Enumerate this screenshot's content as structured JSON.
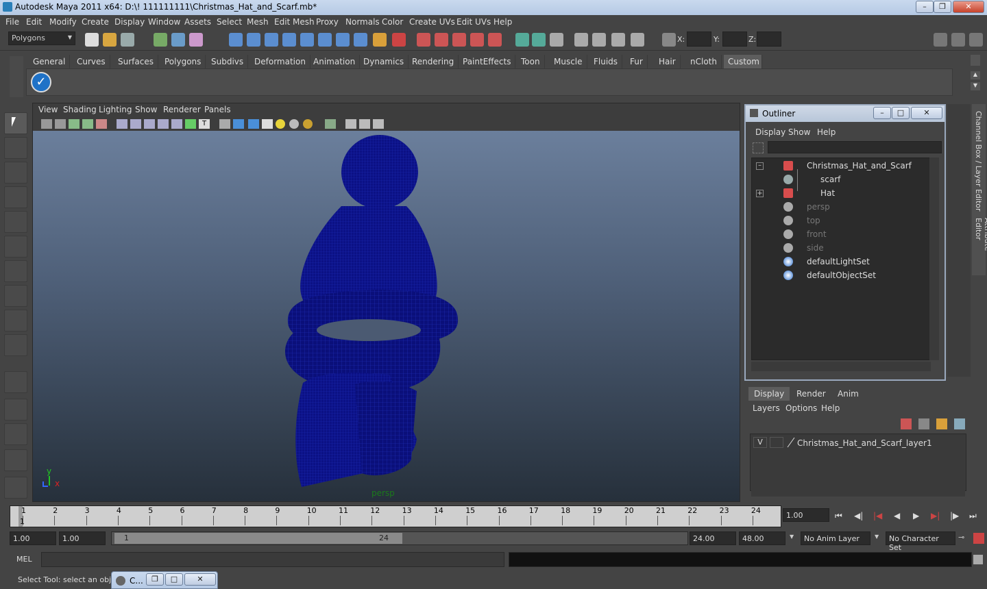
{
  "window": {
    "title": "Autodesk Maya 2011 x64: D:\\! 111111111\\Christmas_Hat_and_Scarf.mb*"
  },
  "menus": [
    "File",
    "Edit",
    "Modify",
    "Create",
    "Display",
    "Window",
    "Assets",
    "Select",
    "Mesh",
    "Edit Mesh",
    "Proxy",
    "Normals",
    "Color",
    "Create UVs",
    "Edit UVs",
    "Help"
  ],
  "status": {
    "mode": "Polygons",
    "x_label": "X:",
    "y_label": "Y:",
    "z_label": "Z:"
  },
  "shelf": {
    "tabs": [
      "General",
      "Curves",
      "Surfaces",
      "Polygons",
      "Subdivs",
      "Deformation",
      "Animation",
      "Dynamics",
      "Rendering",
      "PaintEffects",
      "Toon",
      "Muscle",
      "Fluids",
      "Fur",
      "Hair",
      "nCloth",
      "Custom"
    ],
    "active": "Custom"
  },
  "viewport": {
    "menus": [
      "View",
      "Shading",
      "Lighting",
      "Show",
      "Renderer",
      "Panels"
    ],
    "camera_label": "persp",
    "axis_y": "y",
    "axis_x": "x"
  },
  "outliner": {
    "title": "Outliner",
    "menus": [
      "Display",
      "Show",
      "Help"
    ],
    "items": [
      {
        "label": "Christmas_Hat_and_Scarf",
        "icon": "transform-icon",
        "dim": false,
        "indent": 0
      },
      {
        "label": "scarf",
        "icon": "mesh-icon",
        "dim": false,
        "indent": 1
      },
      {
        "label": "Hat",
        "icon": "transform-icon",
        "dim": false,
        "indent": 1
      },
      {
        "label": "persp",
        "icon": "camera-icon",
        "dim": true,
        "indent": 0
      },
      {
        "label": "top",
        "icon": "camera-icon",
        "dim": true,
        "indent": 0
      },
      {
        "label": "front",
        "icon": "camera-icon",
        "dim": true,
        "indent": 0
      },
      {
        "label": "side",
        "icon": "camera-icon",
        "dim": true,
        "indent": 0
      },
      {
        "label": "defaultLightSet",
        "icon": "set-icon",
        "dim": false,
        "indent": 0
      },
      {
        "label": "defaultObjectSet",
        "icon": "set-icon",
        "dim": false,
        "indent": 0
      }
    ]
  },
  "side_tabs": {
    "channel_box": "Channel Box / Layer Editor",
    "attribute_editor": "Attribute Editor"
  },
  "layers": {
    "tabs": [
      "Display",
      "Render",
      "Anim"
    ],
    "active": "Display",
    "menus": [
      "Layers",
      "Options",
      "Help"
    ],
    "rows": [
      {
        "visible": "V",
        "name": "Christmas_Hat_and_Scarf_layer1"
      }
    ]
  },
  "timeline": {
    "ticks": [
      "1",
      "2",
      "3",
      "4",
      "5",
      "6",
      "7",
      "8",
      "9",
      "10",
      "11",
      "12",
      "13",
      "14",
      "15",
      "16",
      "17",
      "18",
      "19",
      "20",
      "21",
      "22",
      "23",
      "24"
    ],
    "current_frame": "1",
    "current_time": "1.00"
  },
  "range": {
    "start": "1.00",
    "playback_start": "1.00",
    "slider_start": "1",
    "slider_end": "24",
    "playback_end": "24.00",
    "end": "48.00",
    "anim_layer": "No Anim Layer",
    "character_set": "No Character Set"
  },
  "command_line": {
    "label": "MEL"
  },
  "help_line": {
    "text": "Select Tool: select an object"
  },
  "minimized_window": {
    "label": "C..."
  },
  "colors": {
    "wireframe": "#0a0f7a",
    "ui_bg": "#444444",
    "title_bar": "#c1d2e9",
    "axis_y": "#22c722",
    "axis_x": "#dd2222"
  }
}
